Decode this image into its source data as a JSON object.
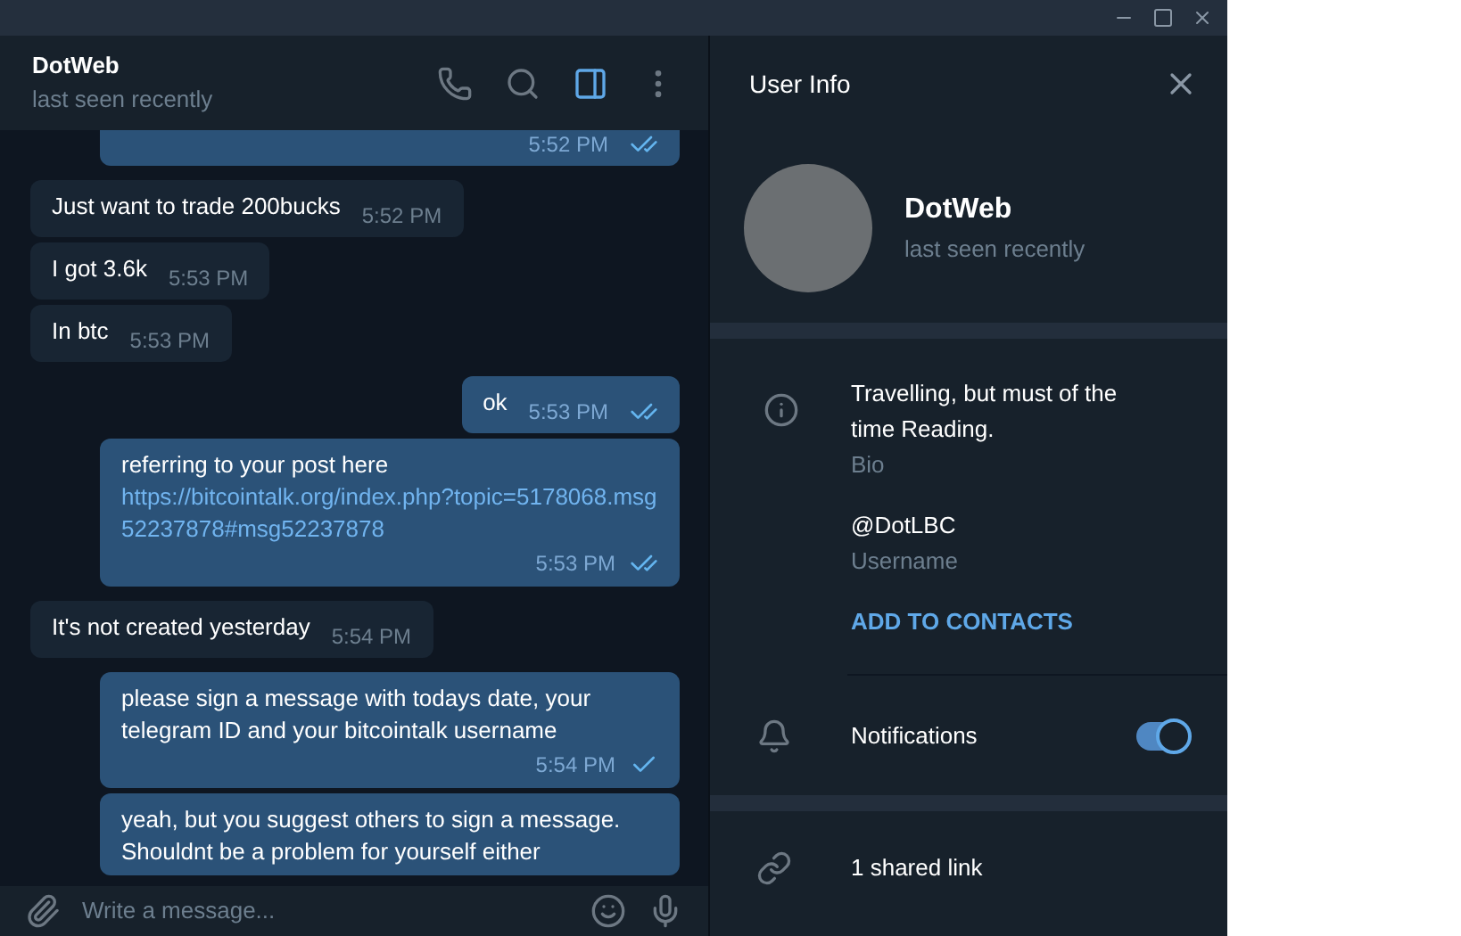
{
  "chat": {
    "title": "DotWeb",
    "status": "last seen recently",
    "messages": [
      {
        "outgoing": true,
        "time": "5:52 PM",
        "read": true
      },
      {
        "outgoing": false,
        "text": "Just want to trade 200bucks",
        "time": "5:52 PM"
      },
      {
        "outgoing": false,
        "text": "I got 3.6k",
        "time": "5:53 PM"
      },
      {
        "outgoing": false,
        "text": "In btc",
        "time": "5:53 PM"
      },
      {
        "outgoing": true,
        "text": "ok",
        "time": "5:53 PM",
        "read": true
      },
      {
        "outgoing": true,
        "text": "referring to your post here",
        "link": "https://bitcointalk.org/index.php?topic=5178068.msg52237878#msg52237878",
        "time": "5:53 PM",
        "read": true
      },
      {
        "outgoing": false,
        "text": "It's not created yesterday",
        "time": "5:54 PM"
      },
      {
        "outgoing": true,
        "text": "please sign a message with todays date, your telegram ID and your bitcointalk username",
        "time": "5:54 PM",
        "read": false
      },
      {
        "outgoing": true,
        "text": "yeah, but you suggest others to sign a message. Shouldnt be a problem for yourself either"
      }
    ],
    "composer": {
      "placeholder": "Write a message..."
    }
  },
  "info_panel": {
    "title": "User Info",
    "name": "DotWeb",
    "status": "last seen recently",
    "bio": "Travelling, but must of the time Reading.",
    "bio_label": "Bio",
    "username": "@DotLBC",
    "username_label": "Username",
    "add_contact": "ADD TO CONTACTS",
    "notifications": {
      "label": "Notifications",
      "on": true
    },
    "shared_links": "1 shared link"
  }
}
